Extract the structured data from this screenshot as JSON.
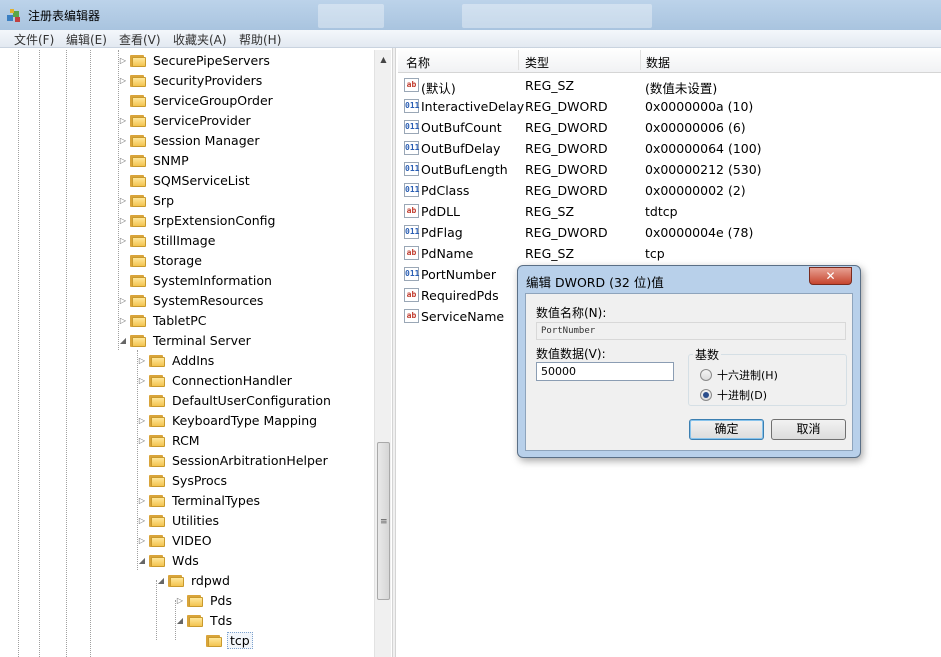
{
  "window": {
    "title": "注册表编辑器"
  },
  "menu": [
    "文件(F)",
    "编辑(E)",
    "查看(V)",
    "收藏夹(A)",
    "帮助(H)"
  ],
  "tree": {
    "items": [
      {
        "label": "SecurePipeServers",
        "expander": "▷"
      },
      {
        "label": "SecurityProviders",
        "expander": "▷"
      },
      {
        "label": "ServiceGroupOrder",
        "expander": ""
      },
      {
        "label": "ServiceProvider",
        "expander": "▷"
      },
      {
        "label": "Session Manager",
        "expander": "▷"
      },
      {
        "label": "SNMP",
        "expander": "▷"
      },
      {
        "label": "SQMServiceList",
        "expander": ""
      },
      {
        "label": "Srp",
        "expander": "▷"
      },
      {
        "label": "SrpExtensionConfig",
        "expander": "▷"
      },
      {
        "label": "StillImage",
        "expander": "▷"
      },
      {
        "label": "Storage",
        "expander": ""
      },
      {
        "label": "SystemInformation",
        "expander": ""
      },
      {
        "label": "SystemResources",
        "expander": "▷"
      },
      {
        "label": "TabletPC",
        "expander": "▷"
      },
      {
        "label": "Terminal Server",
        "expander": "◢"
      },
      {
        "label": "AddIns",
        "expander": "▷"
      },
      {
        "label": "ConnectionHandler",
        "expander": "▷"
      },
      {
        "label": "DefaultUserConfiguration",
        "expander": ""
      },
      {
        "label": "KeyboardType Mapping",
        "expander": "▷"
      },
      {
        "label": "RCM",
        "expander": "▷"
      },
      {
        "label": "SessionArbitrationHelper",
        "expander": ""
      },
      {
        "label": "SysProcs",
        "expander": ""
      },
      {
        "label": "TerminalTypes",
        "expander": "▷"
      },
      {
        "label": "Utilities",
        "expander": "▷"
      },
      {
        "label": "VIDEO",
        "expander": "▷"
      },
      {
        "label": "Wds",
        "expander": "◢"
      },
      {
        "label": "rdpwd",
        "expander": "◢"
      },
      {
        "label": "Pds",
        "expander": "▷"
      },
      {
        "label": "Tds",
        "expander": "◢"
      },
      {
        "label": "tcp",
        "expander": ""
      }
    ]
  },
  "list": {
    "columns": [
      "名称",
      "类型",
      "数据"
    ],
    "rows": [
      {
        "icon": "ab",
        "name": "(默认)",
        "type": "REG_SZ",
        "data": "(数值未设置)"
      },
      {
        "icon": "011",
        "name": "InteractiveDelay",
        "type": "REG_DWORD",
        "data": "0x0000000a (10)"
      },
      {
        "icon": "011",
        "name": "OutBufCount",
        "type": "REG_DWORD",
        "data": "0x00000006 (6)"
      },
      {
        "icon": "011",
        "name": "OutBufDelay",
        "type": "REG_DWORD",
        "data": "0x00000064 (100)"
      },
      {
        "icon": "011",
        "name": "OutBufLength",
        "type": "REG_DWORD",
        "data": "0x00000212 (530)"
      },
      {
        "icon": "011",
        "name": "PdClass",
        "type": "REG_DWORD",
        "data": "0x00000002 (2)"
      },
      {
        "icon": "ab",
        "name": "PdDLL",
        "type": "REG_SZ",
        "data": "tdtcp"
      },
      {
        "icon": "011",
        "name": "PdFlag",
        "type": "REG_DWORD",
        "data": "0x0000004e (78)"
      },
      {
        "icon": "ab",
        "name": "PdName",
        "type": "REG_SZ",
        "data": "tcp"
      },
      {
        "icon": "011",
        "name": "PortNumber",
        "type": "",
        "data": ""
      },
      {
        "icon": "ab",
        "name": "RequiredPds",
        "type": "",
        "data": ""
      },
      {
        "icon": "ab",
        "name": "ServiceName",
        "type": "",
        "data": ""
      }
    ]
  },
  "dialog": {
    "title": "编辑 DWORD (32 位)值",
    "close_label": "✕",
    "name_label": "数值名称(N):",
    "name_value": "PortNumber",
    "data_label": "数值数据(V):",
    "data_value": "50000",
    "base_label": "基数",
    "hex_label": "十六进制(H)",
    "dec_label": "十进制(D)",
    "ok_label": "确定",
    "cancel_label": "取消",
    "selected_base": "decimal"
  }
}
